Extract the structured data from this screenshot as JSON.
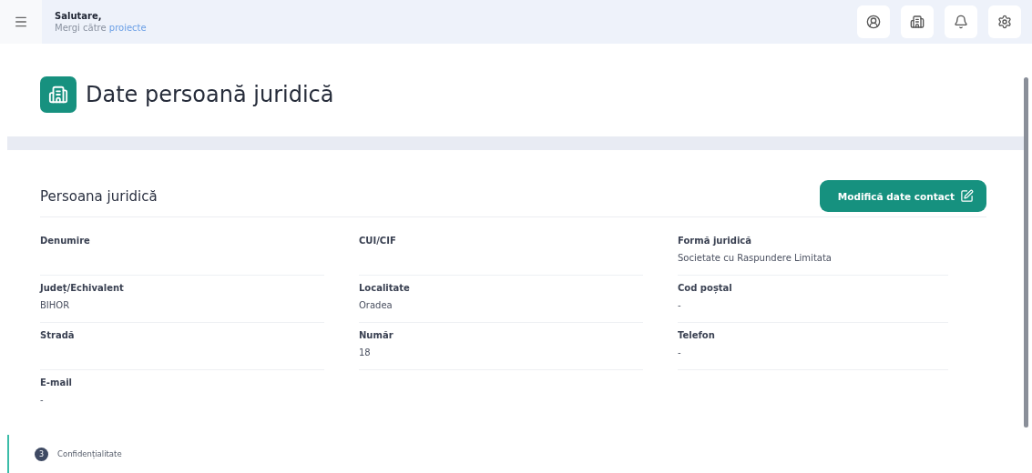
{
  "header": {
    "greeting": "Salutare,",
    "subtitle": "Mergi către",
    "link": "proiecte"
  },
  "page_title": "Date persoană juridică",
  "section": {
    "title": "Persoana juridică",
    "button": "Modifică date contact"
  },
  "fields": [
    {
      "label": "Denumire"
    },
    {
      "label": "CUI/CIF"
    },
    {
      "label": "Formă juridică",
      "value": "Societate cu Raspundere Limitata"
    },
    {
      "label": "Județ/Echivalent",
      "value": "BIHOR"
    },
    {
      "label": "Localitate",
      "value": "Oradea"
    },
    {
      "label": "Cod poștal",
      "value": "-"
    },
    {
      "label": "Stradă"
    },
    {
      "label": "Număr",
      "value": "18"
    },
    {
      "label": "Telefon",
      "value": "-"
    },
    {
      "label": "E-mail",
      "value": "-"
    }
  ],
  "step": {
    "number": "3",
    "label": "Confidențialitate"
  }
}
